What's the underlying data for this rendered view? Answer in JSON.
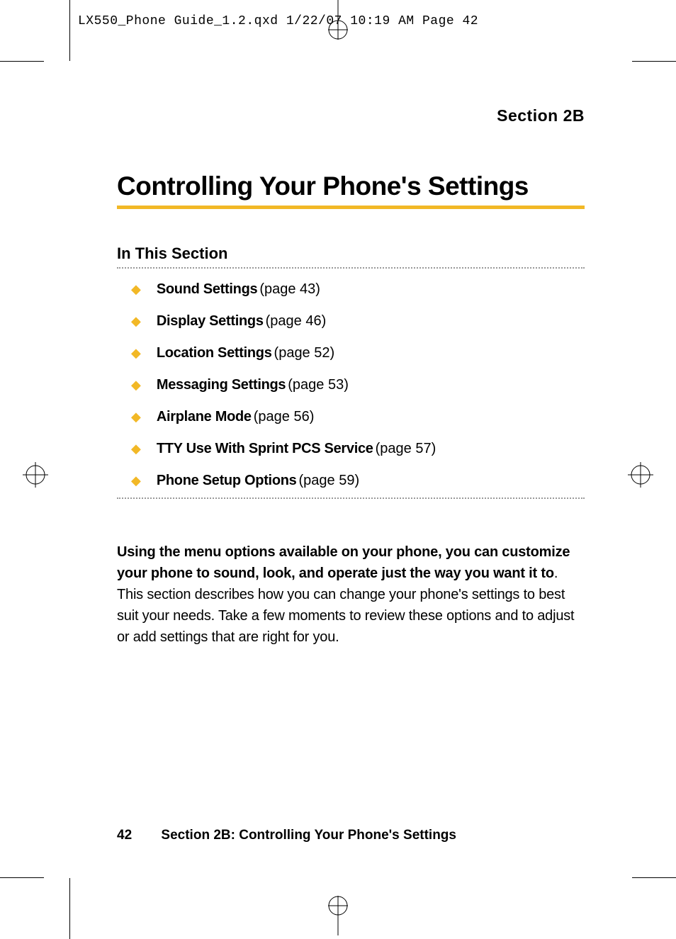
{
  "header": {
    "file_info": "LX550_Phone Guide_1.2.qxd  1/22/07  10:19 AM  Page 42"
  },
  "section_label": "Section 2B",
  "title": "Controlling Your Phone's Settings",
  "subsection": "In This Section",
  "toc": [
    {
      "label": "Sound Settings",
      "page": "(page 43)"
    },
    {
      "label": "Display Settings",
      "page": "(page 46)"
    },
    {
      "label": "Location Settings",
      "page": "(page 52)"
    },
    {
      "label": "Messaging Settings",
      "page": "(page 53)"
    },
    {
      "label": "Airplane Mode",
      "page": "(page 56)"
    },
    {
      "label": "TTY Use With Sprint PCS Service",
      "page": "(page 57)"
    },
    {
      "label": "Phone Setup Options",
      "page": "(page 59)"
    }
  ],
  "body": {
    "lead_bold": "Using the menu options available on your phone, you can customize your phone to sound, look, and operate just the way you want it to",
    "rest": ". This section describes how you can change your phone's settings to best suit your needs. Take a few moments to review these options and to adjust or add settings that are right for you."
  },
  "footer": {
    "page_num": "42",
    "text": "Section 2B: Controlling Your Phone's Settings"
  }
}
